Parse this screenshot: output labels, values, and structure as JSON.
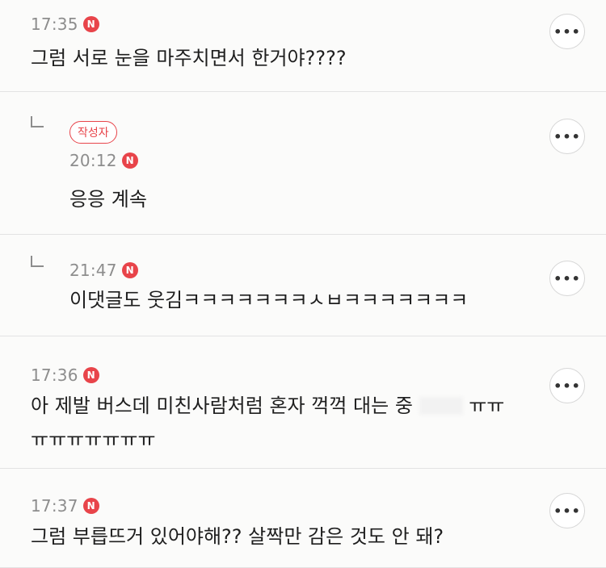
{
  "comments": [
    {
      "time": "17:35",
      "badge": "N",
      "text": "그럼 서로 눈을 마주치면서 한거야????",
      "more": "•••"
    },
    {
      "author_label": "작성자",
      "time": "20:12",
      "badge": "N",
      "text": "응응 계속",
      "more": "•••"
    },
    {
      "time": "21:47",
      "badge": "N",
      "text": "이댓글도 웃김ㅋㅋㅋㅋㅋㅋㅋㅅㅂㅋㅋㅋㅋㅋㅋㅋ",
      "more": "•••"
    },
    {
      "time": "17:36",
      "badge": "N",
      "text_line1": "아 제발 버스데 미친사람처럼 혼자 꺽꺽 대는 중",
      "text_line1_end": "ㅠㅠ",
      "text_line2": "ㅠㅠㅠㅠㅠㅠㅠ",
      "more": "•••"
    },
    {
      "time": "17:37",
      "badge": "N",
      "text": "그럼 부릅뜨거 있어야해?? 살짝만 감은 것도 안 돼?",
      "more": "•••"
    }
  ],
  "colors": {
    "accent": "#e8444a",
    "time": "#8d8d8d",
    "text": "#1e1e1e",
    "divider": "#e3e3e3"
  }
}
